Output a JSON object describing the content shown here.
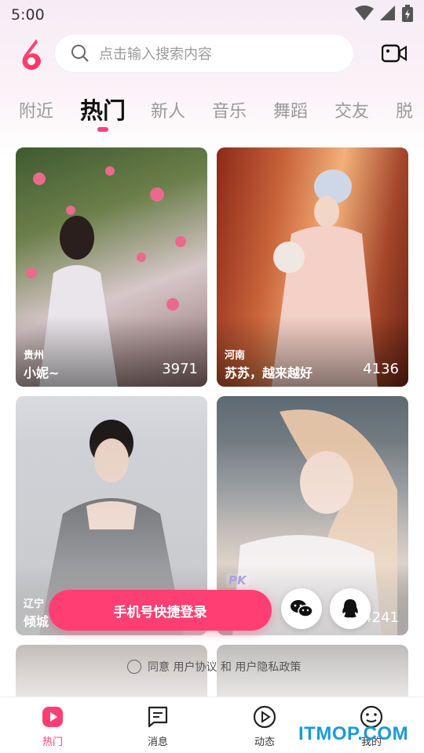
{
  "status_bar": {
    "time": "5:00",
    "icons": [
      "wifi-icon",
      "signal-icon",
      "battery-icon"
    ]
  },
  "header": {
    "search_placeholder": "点击输入搜索内容"
  },
  "tabs": [
    {
      "label": "附近"
    },
    {
      "label": "热门",
      "active": true
    },
    {
      "label": "新人"
    },
    {
      "label": "音乐"
    },
    {
      "label": "舞蹈"
    },
    {
      "label": "交友"
    },
    {
      "label": "脱"
    }
  ],
  "cards": [
    {
      "region": "贵州",
      "name": "小妮~",
      "count": "3971"
    },
    {
      "region": "河南",
      "name": "苏苏，越来越好",
      "count": "4136"
    },
    {
      "region": "辽宁",
      "name": "倾城",
      "count": ""
    },
    {
      "region": "",
      "name": "",
      "count": "4241",
      "badge": "PK"
    }
  ],
  "login": {
    "phone_button": "手机号快捷登录",
    "agree_text": "同意 用户协议 和 用户隐私政策"
  },
  "bottom_nav": [
    {
      "label": "热门",
      "icon": "live-icon",
      "active": true
    },
    {
      "label": "消息",
      "icon": "message-icon"
    },
    {
      "label": "动态",
      "icon": "play-icon"
    },
    {
      "label": "我的",
      "icon": "profile-icon"
    }
  ],
  "watermark": "ITMOP.COM",
  "colors": {
    "accent": "#ff3f73",
    "tab_active": "#111111",
    "tab_inactive": "#9a9a9a"
  }
}
